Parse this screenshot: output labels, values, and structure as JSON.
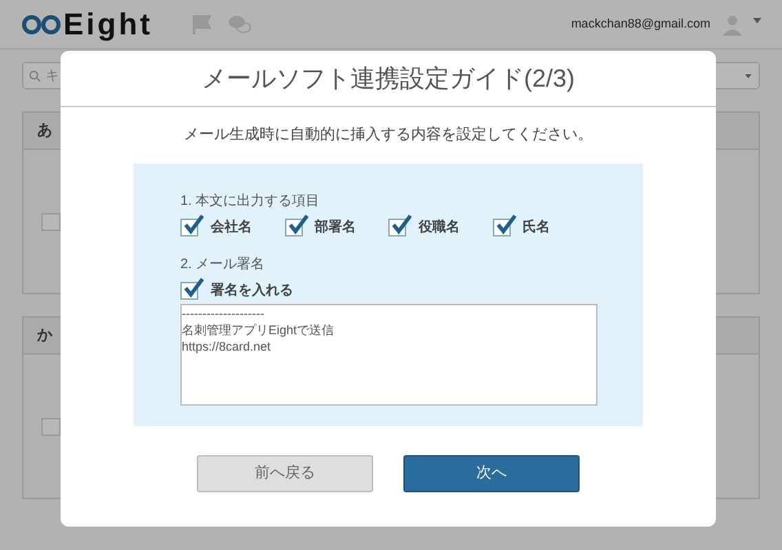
{
  "header": {
    "logo": "Eight",
    "email": "mackchan88@gmail.com"
  },
  "background": {
    "search_placeholder": "キ",
    "sections": [
      {
        "title": "あ",
        "checked": false
      },
      {
        "title": "か",
        "checked": false
      }
    ]
  },
  "modal": {
    "title": "メールソフト連携設定ガイド(2/3)",
    "description": "メール生成時に自動的に挿入する内容を設定してください。",
    "groups": [
      {
        "heading": "1. 本文に出力する項目",
        "options": [
          {
            "label": "会社名",
            "checked": true
          },
          {
            "label": "部署名",
            "checked": true
          },
          {
            "label": "役職名",
            "checked": true
          },
          {
            "label": "氏名",
            "checked": true
          }
        ]
      },
      {
        "heading": "2. メール署名",
        "options": [
          {
            "label": "署名を入れる",
            "checked": true
          }
        ]
      }
    ],
    "signature": "--------------------\n名刺管理アプリEightで送信\nhttps://8card.net",
    "buttons": [
      {
        "label": "前へ戻る",
        "kind": "secondary"
      },
      {
        "label": "次へ",
        "kind": "primary"
      }
    ]
  }
}
